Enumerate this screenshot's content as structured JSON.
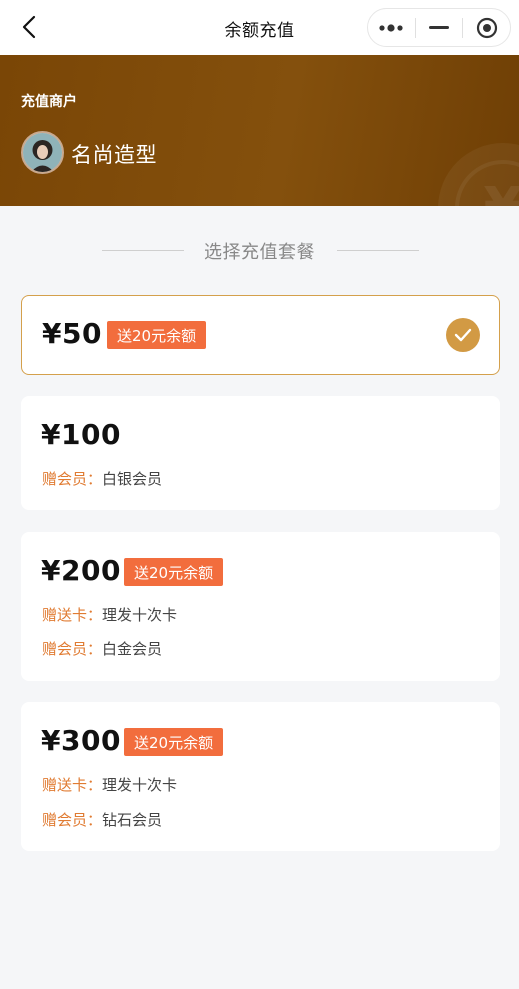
{
  "nav": {
    "title": "余额充值",
    "back_icon": "chevron-left-icon",
    "capsule_icons": [
      "more-dots-icon",
      "minimize-icon",
      "close-circle-icon"
    ]
  },
  "merchant": {
    "label": "充值商户",
    "name": "名尚造型",
    "avatar_icon": "merchant-avatar"
  },
  "section": {
    "title": "选择充值套餐"
  },
  "colors": {
    "banner": "#7a4606",
    "accent": "#d29a44",
    "tag": "#f26d3d",
    "gift_key": "#e07b32"
  },
  "packages": [
    {
      "price": "¥50",
      "tag": "送20元余额",
      "selected": true,
      "gifts": []
    },
    {
      "price": "¥100",
      "tag": "",
      "selected": false,
      "gifts": [
        {
          "key": "赠会员：",
          "value": "白银会员"
        }
      ]
    },
    {
      "price": "¥200",
      "tag": "送20元余额",
      "selected": false,
      "gifts": [
        {
          "key": "赠送卡：",
          "value": "理发十次卡"
        },
        {
          "key": "赠会员：",
          "value": "白金会员"
        }
      ]
    },
    {
      "price": "¥300",
      "tag": "送20元余额",
      "selected": false,
      "gifts": [
        {
          "key": "赠送卡：",
          "value": "理发十次卡"
        },
        {
          "key": "赠会员：",
          "value": "钻石会员"
        }
      ]
    }
  ]
}
